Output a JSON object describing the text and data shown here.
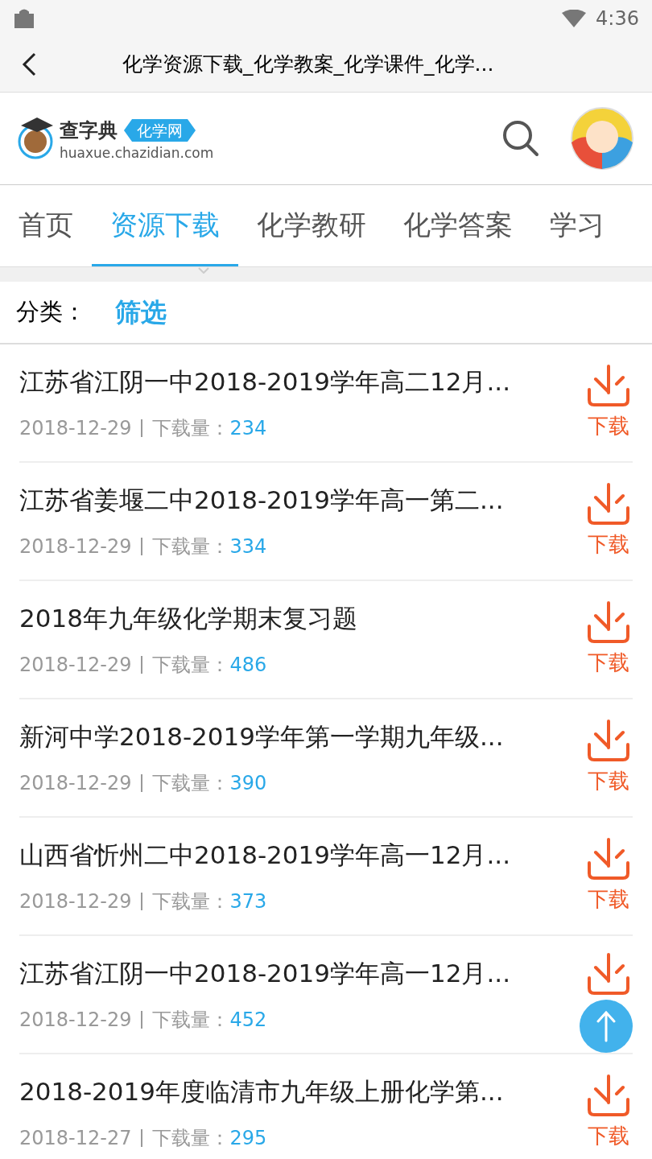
{
  "status_bar": {
    "time": "4:36"
  },
  "title_bar": {
    "title": "化学资源下载_化学教案_化学课件_化学..."
  },
  "logo": {
    "name": "查字典",
    "badge": "化学网",
    "domain": "huaxue.chazidian.com"
  },
  "tabs": [
    {
      "label": "首页",
      "selected": false
    },
    {
      "label": "资源下载",
      "selected": true
    },
    {
      "label": "化学教研",
      "selected": false
    },
    {
      "label": "化学答案",
      "selected": false
    },
    {
      "label": "学习",
      "selected": false
    }
  ],
  "filter": {
    "label": "分类：",
    "link": "筛选"
  },
  "items": [
    {
      "title": "江苏省江阴一中2018-2019学年高二12月...",
      "date": "2018-12-29",
      "count_label": "下载量：",
      "count": "234",
      "action": "下载"
    },
    {
      "title": "江苏省姜堰二中2018-2019学年高一第二...",
      "date": "2018-12-29",
      "count_label": "下载量：",
      "count": "334",
      "action": "下载"
    },
    {
      "title": "2018年九年级化学期末复习题",
      "date": "2018-12-29",
      "count_label": "下载量：",
      "count": "486",
      "action": "下载"
    },
    {
      "title": "新河中学2018-2019学年第一学期九年级...",
      "date": "2018-12-29",
      "count_label": "下载量：",
      "count": "390",
      "action": "下载"
    },
    {
      "title": "山西省忻州二中2018-2019学年高一12月...",
      "date": "2018-12-29",
      "count_label": "下载量：",
      "count": "373",
      "action": "下载"
    },
    {
      "title": "江苏省江阴一中2018-2019学年高一12月...",
      "date": "2018-12-29",
      "count_label": "下载量：",
      "count": "452"
    },
    {
      "title": "2018-2019年度临清市九年级上册化学第...",
      "date": "2018-12-27",
      "count_label": "下载量：",
      "count": "295",
      "action": "下载"
    }
  ]
}
